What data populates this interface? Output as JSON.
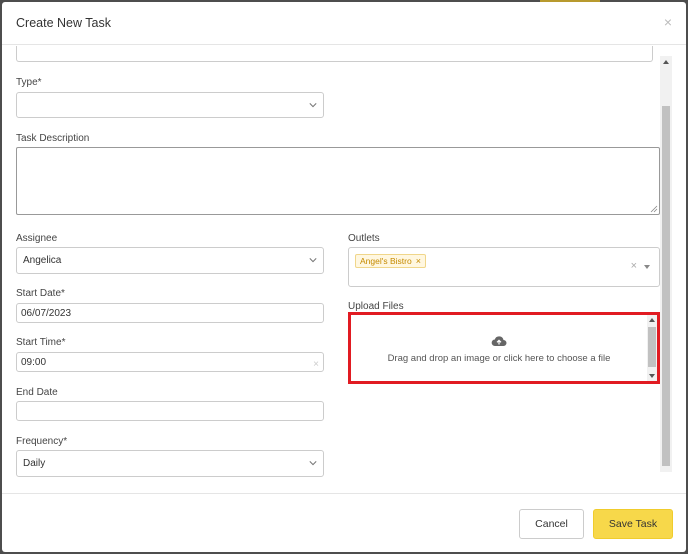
{
  "modal": {
    "title": "Create New Task",
    "close_label": "×"
  },
  "form": {
    "type": {
      "label": "Type*",
      "value": ""
    },
    "description": {
      "label": "Task Description",
      "value": ""
    },
    "assignee": {
      "label": "Assignee",
      "value": "Angelica"
    },
    "outlets": {
      "label": "Outlets",
      "tags": [
        "Angel's Bistro"
      ],
      "tag_remove": "×",
      "clear": "×"
    },
    "start_date": {
      "label": "Start Date*",
      "value": "06/07/2023"
    },
    "start_time": {
      "label": "Start Time*",
      "value": "09:00",
      "clear": "×"
    },
    "end_date": {
      "label": "End Date",
      "value": ""
    },
    "frequency": {
      "label": "Frequency*",
      "value": "Daily"
    },
    "upload": {
      "label": "Upload Files",
      "prompt": "Drag and drop an image or click here to choose a file",
      "icon": "cloud-upload-icon"
    }
  },
  "footer": {
    "cancel_label": "Cancel",
    "save_label": "Save Task"
  },
  "colors": {
    "accent_yellow": "#f7d84a",
    "highlight_red": "#e11b22",
    "tag_text": "#c58a00"
  }
}
